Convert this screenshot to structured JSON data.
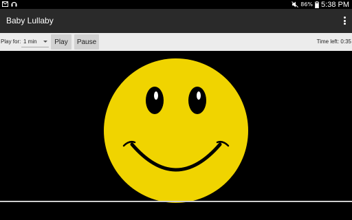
{
  "status_bar": {
    "icons": [
      "mail-icon",
      "headphones-icon",
      "mute-icon",
      "battery-icon"
    ],
    "battery": "86%",
    "time": "5:38 PM"
  },
  "app_bar": {
    "title": "Baby Lullaby",
    "overflow_icon": "overflow-menu-icon"
  },
  "controls": {
    "play_for_label": "Play for:",
    "duration": "1 min",
    "play_label": "Play",
    "pause_label": "Pause",
    "time_left": "Time left: 0:35"
  },
  "colors": {
    "smiley_face": "#f0d400",
    "feature": "#000000",
    "background": "#000000"
  }
}
